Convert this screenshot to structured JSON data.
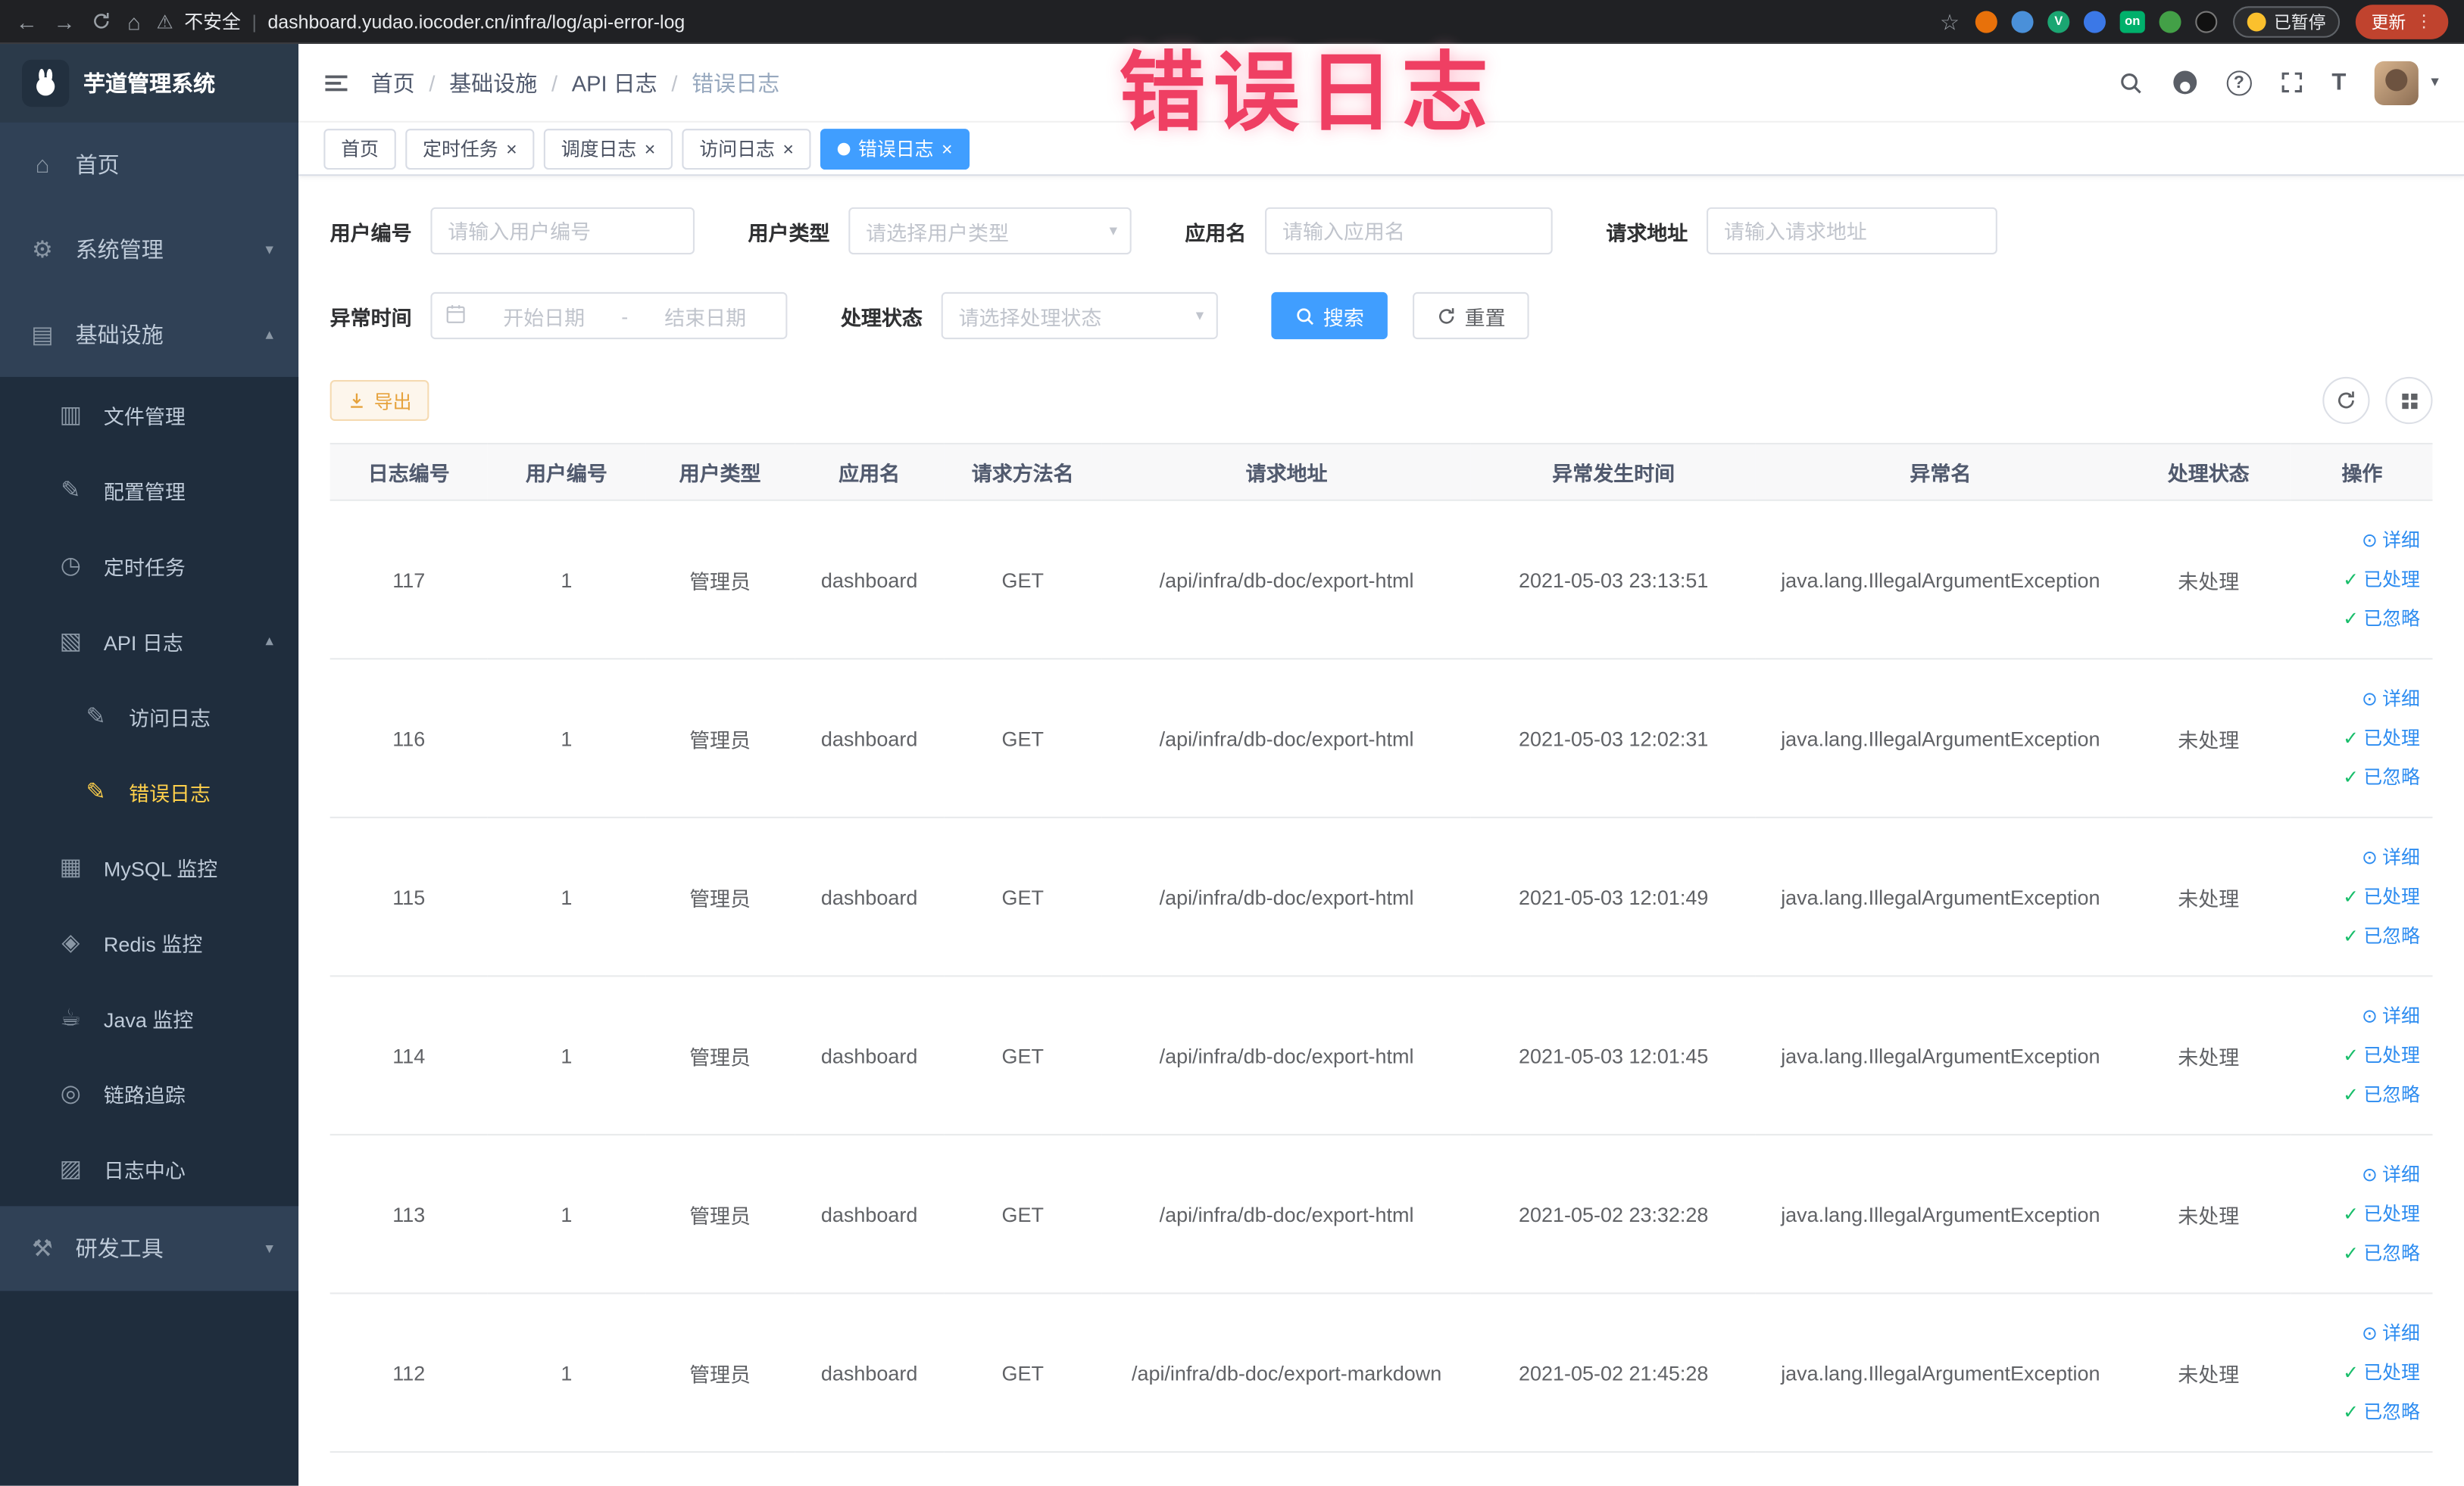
{
  "annotation": {
    "title": "错误日志"
  },
  "colors": {
    "primary": "#409eff",
    "warning": "#e6a23c",
    "success": "#19be6b",
    "sidebar_bg": "#304156",
    "sidebar_active_text": "#ffd04b",
    "annotation_text": "#ef3f63"
  },
  "browser": {
    "security_label": "不安全",
    "url": "dashboard.yudao.iocoder.cn/infra/log/api-error-log",
    "paused_badge": "已暂停",
    "update_button": "更新",
    "extension_on_label": "on"
  },
  "sidebar": {
    "logo_title": "芋道管理系统",
    "items": [
      {
        "label": "首页"
      },
      {
        "label": "系统管理"
      },
      {
        "label": "基础设施"
      },
      {
        "label": "研发工具"
      }
    ],
    "infra_children": [
      {
        "label": "文件管理"
      },
      {
        "label": "配置管理"
      },
      {
        "label": "定时任务"
      },
      {
        "label": "API 日志"
      },
      {
        "label": "MySQL 监控"
      },
      {
        "label": "Redis 监控"
      },
      {
        "label": "Java 监控"
      },
      {
        "label": "链路追踪"
      },
      {
        "label": "日志中心"
      }
    ],
    "api_log_children": [
      {
        "label": "访问日志"
      },
      {
        "label": "错误日志"
      }
    ]
  },
  "header": {
    "breadcrumb": [
      "首页",
      "基础设施",
      "API 日志",
      "错误日志"
    ]
  },
  "tabs": [
    {
      "label": "首页"
    },
    {
      "label": "定时任务"
    },
    {
      "label": "调度日志"
    },
    {
      "label": "访问日志"
    },
    {
      "label": "错误日志"
    }
  ],
  "filters": {
    "user_id": {
      "label": "用户编号",
      "placeholder": "请输入用户编号"
    },
    "user_type": {
      "label": "用户类型",
      "placeholder": "请选择用户类型"
    },
    "app_name": {
      "label": "应用名",
      "placeholder": "请输入应用名"
    },
    "request_url": {
      "label": "请求地址",
      "placeholder": "请输入请求地址"
    },
    "exception_time": {
      "label": "异常时间",
      "start_placeholder": "开始日期",
      "separator": "-",
      "end_placeholder": "结束日期"
    },
    "process_status": {
      "label": "处理状态",
      "placeholder": "请选择处理状态"
    },
    "search_button": "搜索",
    "reset_button": "重置"
  },
  "toolbar": {
    "export_button": "导出"
  },
  "table": {
    "columns": [
      "日志编号",
      "用户编号",
      "用户类型",
      "应用名",
      "请求方法名",
      "请求地址",
      "异常发生时间",
      "异常名",
      "处理状态",
      "操作"
    ],
    "action_labels": [
      "详细",
      "已处理",
      "已忽略"
    ],
    "rows": [
      {
        "id": "117",
        "user_id": "1",
        "user_type": "管理员",
        "app": "dashboard",
        "method": "GET",
        "url": "/api/infra/db-doc/export-html",
        "time": "2021-05-03 23:13:51",
        "exception": "java.lang.IllegalArgumentException",
        "status": "未处理"
      },
      {
        "id": "116",
        "user_id": "1",
        "user_type": "管理员",
        "app": "dashboard",
        "method": "GET",
        "url": "/api/infra/db-doc/export-html",
        "time": "2021-05-03 12:02:31",
        "exception": "java.lang.IllegalArgumentException",
        "status": "未处理"
      },
      {
        "id": "115",
        "user_id": "1",
        "user_type": "管理员",
        "app": "dashboard",
        "method": "GET",
        "url": "/api/infra/db-doc/export-html",
        "time": "2021-05-03 12:01:49",
        "exception": "java.lang.IllegalArgumentException",
        "status": "未处理"
      },
      {
        "id": "114",
        "user_id": "1",
        "user_type": "管理员",
        "app": "dashboard",
        "method": "GET",
        "url": "/api/infra/db-doc/export-html",
        "time": "2021-05-03 12:01:45",
        "exception": "java.lang.IllegalArgumentException",
        "status": "未处理"
      },
      {
        "id": "113",
        "user_id": "1",
        "user_type": "管理员",
        "app": "dashboard",
        "method": "GET",
        "url": "/api/infra/db-doc/export-html",
        "time": "2021-05-02 23:32:28",
        "exception": "java.lang.IllegalArgumentException",
        "status": "未处理"
      },
      {
        "id": "112",
        "user_id": "1",
        "user_type": "管理员",
        "app": "dashboard",
        "method": "GET",
        "url": "/api/infra/db-doc/export-markdown",
        "time": "2021-05-02 21:45:28",
        "exception": "java.lang.IllegalArgumentException",
        "status": "未处理"
      }
    ]
  },
  "icons": {
    "back": "←",
    "forward": "→",
    "home_browser": "⌂",
    "warning": "⚠",
    "star": "☆",
    "kebab": "⋮",
    "home": "⌂",
    "system": "⚙",
    "infra": "▤",
    "file": "▥",
    "config": "✎",
    "cron": "◷",
    "api_log": "▧",
    "sub_log": "✎",
    "mysql": "▦",
    "redis": "◈",
    "java": "☕",
    "trace": "◎",
    "log_center": "▨",
    "dev": "⚒",
    "chevron_down": "▾",
    "chevron_up": "▴",
    "caret_down": "▾",
    "close": "×",
    "active_dot": "●",
    "check": "✓",
    "eye": "⊙",
    "text_size": "T"
  }
}
